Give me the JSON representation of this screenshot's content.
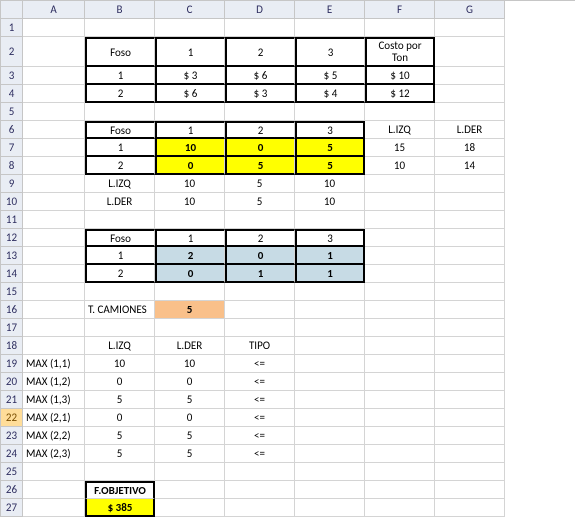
{
  "colhdr": [
    "A",
    "B",
    "C",
    "D",
    "E",
    "F",
    "G"
  ],
  "rowcount": 27,
  "t1": {
    "h": [
      "Foso",
      "1",
      "2",
      "3",
      "Costo por Ton"
    ],
    "r1": [
      "1",
      "$ 3",
      "$ 6",
      "$ 5",
      "$ 10"
    ],
    "r2": [
      "2",
      "$ 6",
      "$ 3",
      "$ 4",
      "$ 12"
    ]
  },
  "t2": {
    "h": [
      "Foso",
      "1",
      "2",
      "3"
    ],
    "r1": [
      "1",
      "10",
      "0",
      "5"
    ],
    "r2": [
      "2",
      "0",
      "5",
      "5"
    ],
    "lizq_lbl": "L.IZQ",
    "lder_lbl": "L.DER",
    "lizq": [
      "10",
      "5",
      "10"
    ],
    "lder": [
      "10",
      "5",
      "10"
    ],
    "side_h": [
      "L.IZQ",
      "L.DER"
    ],
    "side_r1": [
      "15",
      "18"
    ],
    "side_r2": [
      "10",
      "14"
    ]
  },
  "t3": {
    "h": [
      "Foso",
      "1",
      "2",
      "3"
    ],
    "r1": [
      "1",
      "2",
      "0",
      "1"
    ],
    "r2": [
      "2",
      "0",
      "1",
      "1"
    ]
  },
  "tcam": {
    "label": "T. CAMIONES",
    "value": "5"
  },
  "cons": {
    "h": [
      "L.IZQ",
      "L.DER",
      "TIPO"
    ],
    "rows": [
      {
        "name": "MAX (1,1)",
        "l": "10",
        "d": "10",
        "t": "<="
      },
      {
        "name": "MAX (1,2)",
        "l": "0",
        "d": "0",
        "t": "<="
      },
      {
        "name": "MAX (1,3)",
        "l": "5",
        "d": "5",
        "t": "<="
      },
      {
        "name": "MAX (2,1)",
        "l": "0",
        "d": "0",
        "t": "<="
      },
      {
        "name": "MAX (2,2)",
        "l": "5",
        "d": "5",
        "t": "<="
      },
      {
        "name": "MAX (2,3)",
        "l": "5",
        "d": "5",
        "t": "<="
      }
    ]
  },
  "obj": {
    "label": "F.OBJETIVO",
    "value": "$ 385"
  }
}
